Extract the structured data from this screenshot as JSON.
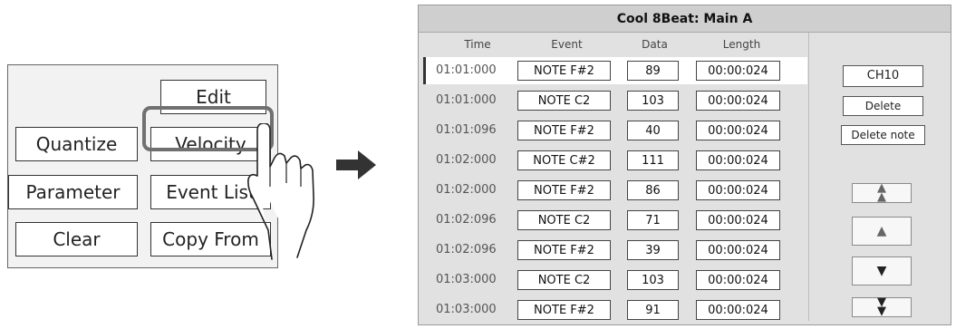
{
  "menu": {
    "edit": "Edit",
    "quantize": "Quantize",
    "velocity": "Velocity",
    "parameter": "Parameter",
    "event_list": "Event List",
    "clear": "Clear",
    "copy_from": "Copy From"
  },
  "screen": {
    "title": "Cool 8Beat: Main A",
    "columns": {
      "time": "Time",
      "event": "Event",
      "data": "Data",
      "length": "Length"
    },
    "rows": [
      {
        "time": "01:01:000",
        "event": "NOTE F#2",
        "data": "89",
        "length": "00:00:024"
      },
      {
        "time": "01:01:000",
        "event": "NOTE C2",
        "data": "103",
        "length": "00:00:024"
      },
      {
        "time": "01:01:096",
        "event": "NOTE F#2",
        "data": "40",
        "length": "00:00:024"
      },
      {
        "time": "01:02:000",
        "event": "NOTE C#2",
        "data": "111",
        "length": "00:00:024"
      },
      {
        "time": "01:02:000",
        "event": "NOTE F#2",
        "data": "86",
        "length": "00:00:024"
      },
      {
        "time": "01:02:096",
        "event": "NOTE C2",
        "data": "71",
        "length": "00:00:024"
      },
      {
        "time": "01:02:096",
        "event": "NOTE F#2",
        "data": "39",
        "length": "00:00:024"
      },
      {
        "time": "01:03:000",
        "event": "NOTE C2",
        "data": "103",
        "length": "00:00:024"
      },
      {
        "time": "01:03:000",
        "event": "NOTE F#2",
        "data": "91",
        "length": "00:00:024"
      }
    ],
    "channel": "CH10",
    "delete": "Delete",
    "delete_note": "Delete note",
    "nav": {
      "page_up": "⩯",
      "up": "▲",
      "down": "▼",
      "page_down": "⩯"
    }
  },
  "icons": [
    "hand-pointer-icon",
    "right-arrow-icon",
    "double-up-icon",
    "up-icon",
    "down-icon",
    "double-down-icon"
  ]
}
